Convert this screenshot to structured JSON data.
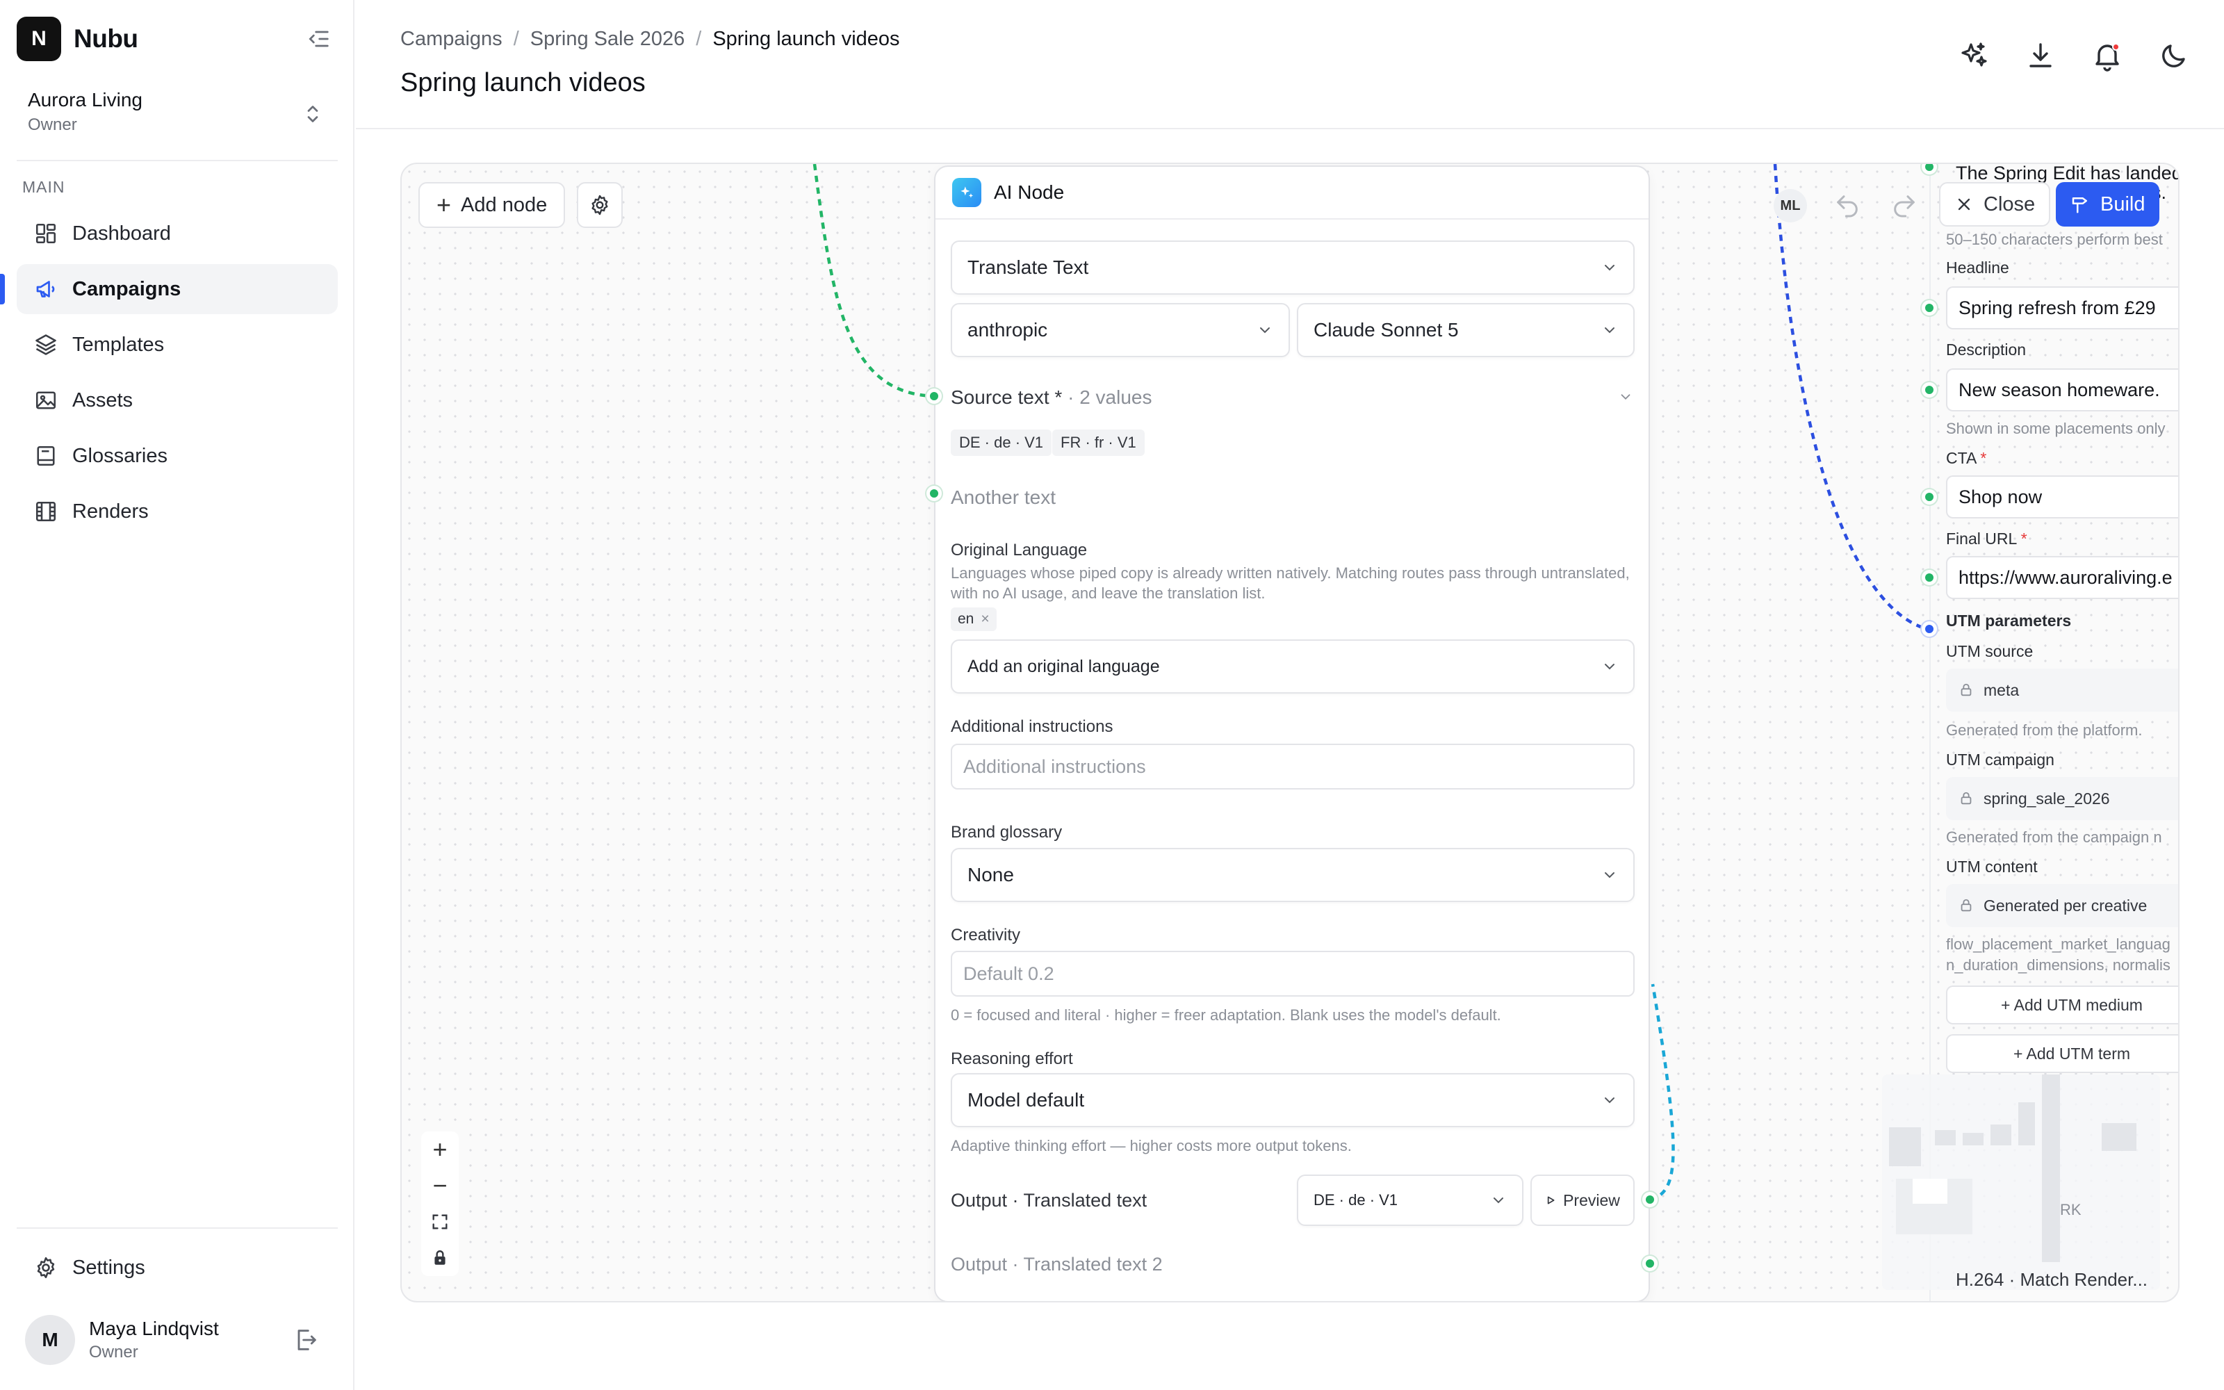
{
  "app": {
    "logo_letter": "N",
    "name": "Nubu"
  },
  "workspace": {
    "name": "Aurora Living",
    "role": "Owner"
  },
  "sidebar": {
    "section_label": "MAIN",
    "items": [
      {
        "label": "Dashboard",
        "icon": "dashboard-icon"
      },
      {
        "label": "Campaigns",
        "icon": "megaphone-icon",
        "active": true
      },
      {
        "label": "Templates",
        "icon": "layers-icon"
      },
      {
        "label": "Assets",
        "icon": "image-icon"
      },
      {
        "label": "Glossaries",
        "icon": "book-icon"
      },
      {
        "label": "Renders",
        "icon": "film-icon"
      }
    ],
    "settings_label": "Settings"
  },
  "user": {
    "initial": "M",
    "name": "Maya Lindqvist",
    "role": "Owner"
  },
  "header": {
    "breadcrumb": [
      "Campaigns",
      "Spring Sale 2026",
      "Spring launch videos"
    ],
    "separator": "/",
    "title": "Spring launch videos"
  },
  "canvas": {
    "add_node_label": "Add node",
    "collaborator_initials": "ML",
    "close_label": "Close",
    "build_label": "Build",
    "zoom_in": "+",
    "zoom_out": "−"
  },
  "ai_node": {
    "title": "AI Node",
    "operation": "Translate Text",
    "provider": "anthropic",
    "model": "Claude Sonnet 5",
    "source_text_label": "Source text *",
    "source_text_count": " · 2 values",
    "source_chips": [
      "DE · de · V1",
      "FR · fr · V1"
    ],
    "another_text_label": "Another text",
    "original_language_label": "Original Language",
    "original_language_hint": "Languages whose piped copy is already written natively. Matching routes pass through untranslated, with no AI usage, and leave the translation list.",
    "original_language_chip": "en",
    "chip_remove": "×",
    "add_language_placeholder": "Add an original language",
    "additional_instructions_label": "Additional instructions",
    "additional_instructions_placeholder": "Additional instructions",
    "brand_glossary_label": "Brand glossary",
    "brand_glossary_value": "None",
    "creativity_label": "Creativity",
    "creativity_placeholder": "Default 0.2",
    "creativity_hint": "0 = focused and literal · higher = freer adaptation. Blank uses the model's default.",
    "reasoning_label": "Reasoning effort",
    "reasoning_value": "Model default",
    "reasoning_hint": "Adaptive thinking effort — higher costs more output tokens.",
    "output_label": "Output · Translated text",
    "output_selector": "DE · de · V1",
    "preview_label": "Preview",
    "output2_label": "Output · Translated text 2"
  },
  "right_panel": {
    "top_text_line1": "The Spring Edit has landed",
    "top_text_line2": "s.",
    "length_hint": "50–150 characters perform best",
    "headline_label": "Headline",
    "headline_value": "Spring refresh from £29",
    "description_label": "Description",
    "description_value": "New season homeware.",
    "description_hint": "Shown in some placements only",
    "cta_label": "CTA",
    "required_mark": "*",
    "cta_value": "Shop now",
    "final_url_label": "Final URL",
    "final_url_value": "https://www.auroraliving.e",
    "utm_params_label": "UTM parameters",
    "utm_source_label": "UTM source",
    "utm_source_value": "meta",
    "utm_source_hint": "Generated from the platform.",
    "utm_campaign_label": "UTM campaign",
    "utm_campaign_value": "spring_sale_2026",
    "utm_campaign_hint": "Generated from the campaign n",
    "utm_content_label": "UTM content",
    "utm_content_value": "Generated per creative",
    "utm_content_hint_line1": "flow_placement_market_languag",
    "utm_content_hint_line2": "n_duration_dimensions, normalis",
    "add_utm_medium": "+ Add UTM medium",
    "add_utm_term": "+ Add UTM term",
    "peek_text": "RK",
    "bottom_text": "H.264 · Match Render..."
  },
  "colors": {
    "accent": "#2c5bf1",
    "wire_green": "#22b566",
    "wire_blue": "#2c4fe0",
    "wire_cyan": "#1aa7d6",
    "notification": "#ef3b3b"
  }
}
